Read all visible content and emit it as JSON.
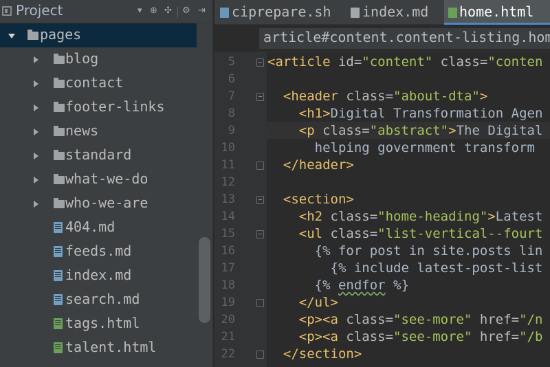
{
  "project_panel": {
    "title": "Project",
    "toolbar": [
      "▾",
      "⊕",
      "✣",
      "⚙",
      "⇥"
    ],
    "tree": [
      {
        "label": "pages",
        "type": "folder",
        "expanded": true,
        "selected": true
      },
      {
        "label": "blog",
        "type": "folder"
      },
      {
        "label": "contact",
        "type": "folder"
      },
      {
        "label": "footer-links",
        "type": "folder"
      },
      {
        "label": "news",
        "type": "folder"
      },
      {
        "label": "standard",
        "type": "folder"
      },
      {
        "label": "what-we-do",
        "type": "folder"
      },
      {
        "label": "who-we-are",
        "type": "folder"
      },
      {
        "label": "404.md",
        "type": "md"
      },
      {
        "label": "feeds.md",
        "type": "md"
      },
      {
        "label": "index.md",
        "type": "md"
      },
      {
        "label": "search.md",
        "type": "md"
      },
      {
        "label": "tags.html",
        "type": "html"
      },
      {
        "label": "talent.html",
        "type": "html"
      }
    ]
  },
  "tabs": [
    {
      "label": "ciprepare.sh",
      "icon": "terminal-file-icon",
      "color": "#6897bb"
    },
    {
      "label": "index.md",
      "icon": "markdown-file-icon",
      "color": "#a4a7a9"
    },
    {
      "label": "home.html",
      "icon": "html-file-icon",
      "color": "#6aa159",
      "active": true
    }
  ],
  "breadcrumb": "article#content.content-listing.hom",
  "editor": {
    "current_line": 9,
    "lines": [
      {
        "n": "5",
        "fold": "open",
        "segs": [
          [
            "tag",
            "<article "
          ],
          [
            "attr",
            "id="
          ],
          [
            "str",
            "\"content\" "
          ],
          [
            "attr",
            "class="
          ],
          [
            "str",
            "\"conten"
          ]
        ]
      },
      {
        "n": "6",
        "segs": []
      },
      {
        "n": "7",
        "fold": "open",
        "segs": [
          [
            "txt",
            "  "
          ],
          [
            "tag",
            "<header "
          ],
          [
            "attr",
            "class="
          ],
          [
            "str",
            "\"about-dta\""
          ],
          [
            "tag",
            ">"
          ]
        ]
      },
      {
        "n": "8",
        "segs": [
          [
            "txt",
            "    "
          ],
          [
            "tag",
            "<h1>"
          ],
          [
            "txt",
            "Digital Transformation Agen"
          ]
        ]
      },
      {
        "n": "9",
        "segs": [
          [
            "txt",
            "    "
          ],
          [
            "tag",
            "<p "
          ],
          [
            "attr",
            "class="
          ],
          [
            "str",
            "\"abstract\""
          ],
          [
            "tag",
            ">"
          ],
          [
            "txt",
            "The Digital"
          ]
        ]
      },
      {
        "n": "10",
        "segs": [
          [
            "txt",
            "      helping government transform "
          ]
        ]
      },
      {
        "n": "11",
        "fold": "close",
        "segs": [
          [
            "txt",
            "  "
          ],
          [
            "tag",
            "</header>"
          ]
        ]
      },
      {
        "n": "12",
        "segs": []
      },
      {
        "n": "13",
        "fold": "open",
        "segs": [
          [
            "txt",
            "  "
          ],
          [
            "tag",
            "<section>"
          ]
        ]
      },
      {
        "n": "14",
        "segs": [
          [
            "txt",
            "    "
          ],
          [
            "tag",
            "<h2 "
          ],
          [
            "attr",
            "class="
          ],
          [
            "str",
            "\"home-heading\""
          ],
          [
            "tag",
            ">"
          ],
          [
            "txt",
            "Latest"
          ]
        ]
      },
      {
        "n": "15",
        "fold": "open",
        "segs": [
          [
            "txt",
            "    "
          ],
          [
            "tag",
            "<ul "
          ],
          [
            "attr",
            "class="
          ],
          [
            "str",
            "\"list-vertical--fourt"
          ]
        ]
      },
      {
        "n": "16",
        "segs": [
          [
            "txt",
            "      "
          ],
          [
            "txt",
            "{% for post in site.posts lin"
          ]
        ]
      },
      {
        "n": "17",
        "segs": [
          [
            "txt",
            "        "
          ],
          [
            "txt",
            "{% include latest-post-list"
          ]
        ]
      },
      {
        "n": "18",
        "segs": [
          [
            "txt",
            "      {% "
          ],
          [
            "sq",
            "endfor"
          ],
          [
            "txt",
            " %}"
          ]
        ]
      },
      {
        "n": "19",
        "fold": "close",
        "segs": [
          [
            "txt",
            "    "
          ],
          [
            "tag",
            "</ul>"
          ]
        ]
      },
      {
        "n": "20",
        "segs": [
          [
            "txt",
            "    "
          ],
          [
            "tag",
            "<p><a "
          ],
          [
            "attr",
            "class="
          ],
          [
            "str",
            "\"see-more\" "
          ],
          [
            "attr",
            "href="
          ],
          [
            "str",
            "\"/n"
          ]
        ]
      },
      {
        "n": "21",
        "segs": [
          [
            "txt",
            "    "
          ],
          [
            "tag",
            "<p><a "
          ],
          [
            "attr",
            "class="
          ],
          [
            "str",
            "\"see-more\" "
          ],
          [
            "attr",
            "href="
          ],
          [
            "str",
            "\"/b"
          ]
        ]
      },
      {
        "n": "22",
        "fold": "close",
        "segs": [
          [
            "txt",
            "  "
          ],
          [
            "tag",
            "</section>"
          ]
        ]
      }
    ]
  },
  "colors": {
    "accent": "#4a88c7",
    "tag": "#e8bf6a",
    "attr": "#bababa",
    "string": "#a5c25c",
    "text": "#a9b7c6",
    "selection": "#0d293e"
  }
}
